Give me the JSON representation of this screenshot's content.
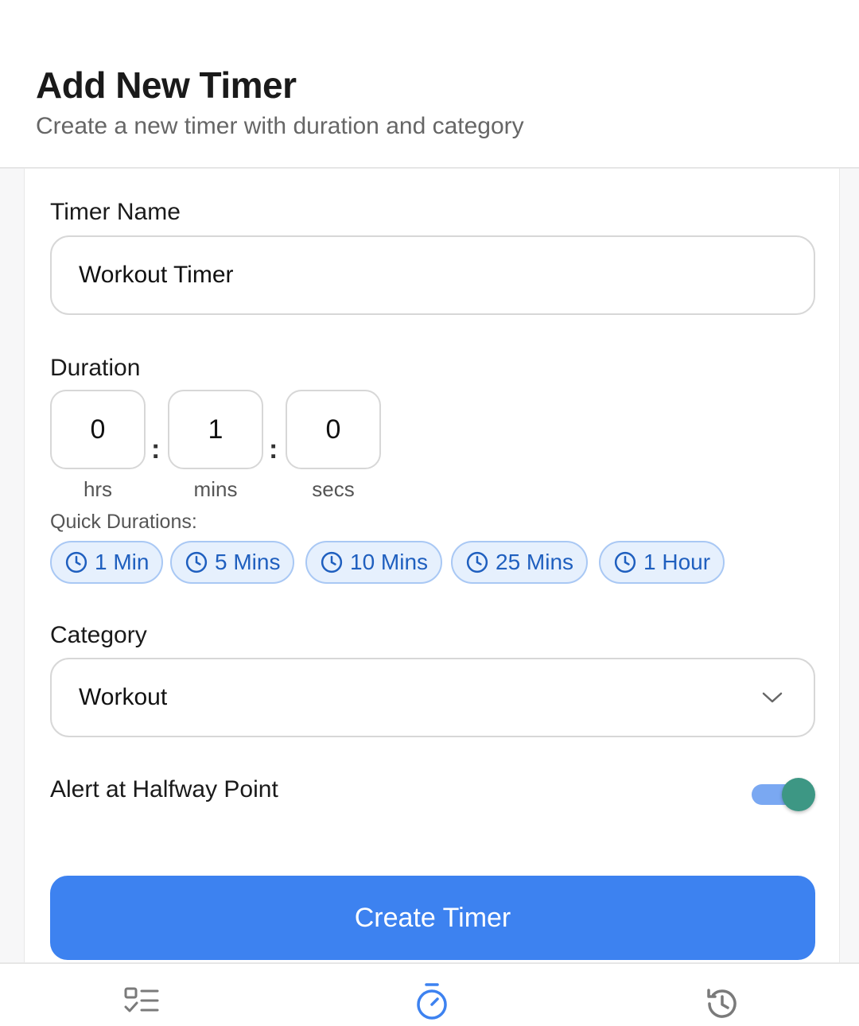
{
  "header": {
    "title": "Add New Timer",
    "subtitle": "Create a new timer with duration and category"
  },
  "form": {
    "name_label": "Timer Name",
    "name_value": "Workout Timer",
    "duration_label": "Duration",
    "duration": {
      "hours": "0",
      "minutes": "1",
      "seconds": "0",
      "separator": ":",
      "hours_unit": "hrs",
      "minutes_unit": "mins",
      "seconds_unit": "secs"
    },
    "quick_label": "Quick Durations:",
    "quick_durations": [
      {
        "label": "1 Min",
        "icon": "clock-icon"
      },
      {
        "label": "5 Mins",
        "icon": "clock-icon"
      },
      {
        "label": "10 Mins",
        "icon": "clock-icon"
      },
      {
        "label": "25 Mins",
        "icon": "clock-icon"
      },
      {
        "label": "1 Hour",
        "icon": "clock-icon"
      }
    ],
    "category_label": "Category",
    "category_value": "Workout",
    "halfway_label": "Alert at Halfway Point",
    "halfway_enabled": true,
    "submit_label": "Create Timer"
  },
  "bottom_nav": {
    "items": [
      {
        "icon": "task-list-icon",
        "active": false
      },
      {
        "icon": "stopwatch-icon",
        "active": true
      },
      {
        "icon": "history-icon",
        "active": false
      }
    ]
  },
  "colors": {
    "accent": "#3d82f0",
    "chip_bg": "#e6f0fd",
    "chip_text": "#1f5fbf",
    "toggle_track": "#7aa8f2",
    "toggle_knob": "#3d9784",
    "nav_inactive": "#7a7a7a"
  }
}
